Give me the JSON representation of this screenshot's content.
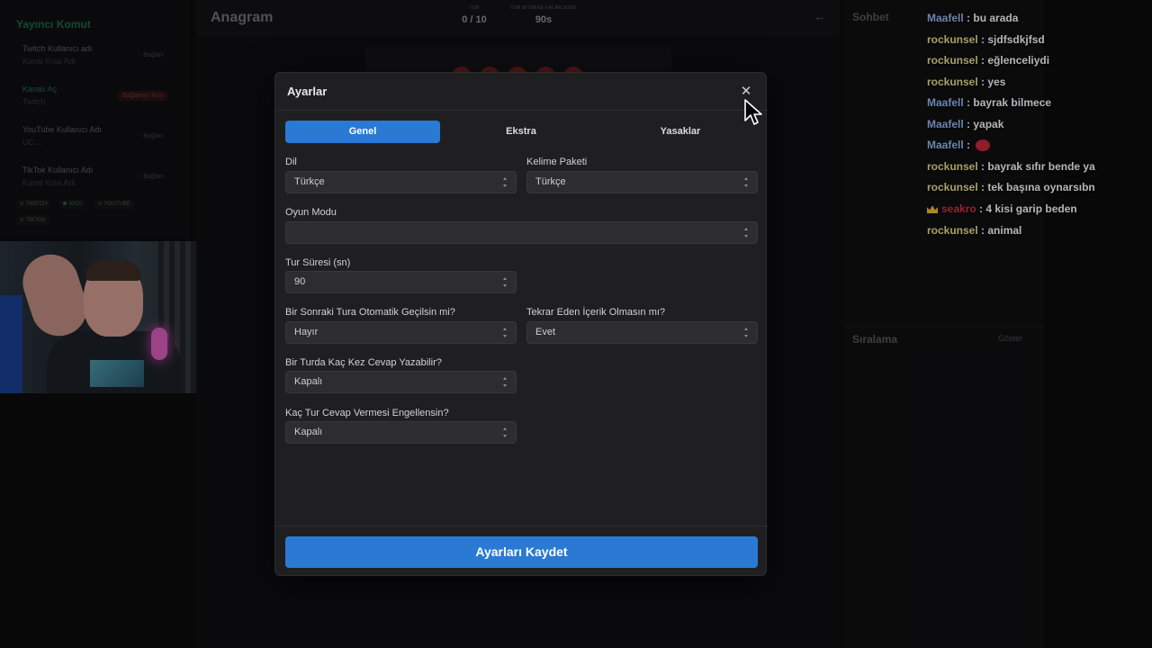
{
  "left_panel": {
    "title": "Yayıncı Komut",
    "connections": [
      {
        "label": "Twitch Kullanıcı adı",
        "sub": "Kanal Kısa Adı",
        "action": "Bağlan"
      },
      {
        "label": "Kanalı Aç",
        "sub": "Twitch",
        "action": "Bağlantıyı Kes"
      },
      {
        "label": "YouTube Kullanıcı Adı",
        "sub": "UC...",
        "action": "Bağlan"
      },
      {
        "label": "TikTok Kullanıcı Adı",
        "sub": "Kanal Kısa Adı",
        "action": "Bağlan"
      }
    ],
    "platforms": [
      "TWITCH",
      "KİCK",
      "YOUTUBE",
      "TİKTOK"
    ]
  },
  "game": {
    "title": "Anagram",
    "round_caption": "TUR",
    "round_value": "0 / 10",
    "timer_caption": "TUR BİTİMİNE KALAN SÜRE",
    "timer_value": "90s",
    "back_icon": "arrow-left-icon"
  },
  "right_panel": {
    "chat_title": "Sohbet",
    "ranking_title": "Sıralama",
    "ranking_action": "Göster"
  },
  "stream_chat": [
    {
      "user": "Maafell",
      "color": "#8fb4e8",
      "message": "bu arada"
    },
    {
      "user": "rockunsel",
      "color": "#e6d68a",
      "message": "sjdfsdkjfsd"
    },
    {
      "user": "rockunsel",
      "color": "#e6d68a",
      "message": "eğlenceliydi"
    },
    {
      "user": "rockunsel",
      "color": "#e6d68a",
      "message": "yes"
    },
    {
      "user": "Maafell",
      "color": "#8fb4e8",
      "message": "bayrak bilmece"
    },
    {
      "user": "Maafell",
      "color": "#8fb4e8",
      "message": "yapak"
    },
    {
      "user": "Maafell",
      "color": "#8fb4e8",
      "message": ""
    },
    {
      "user": "rockunsel",
      "color": "#e6d68a",
      "message": "bayrak sıfır bende ya"
    },
    {
      "user": "rockunsel",
      "color": "#e6d68a",
      "message": "tek başına oynarsıbn"
    },
    {
      "user": "seakro",
      "color": "#d42a3c",
      "message": "4 kisi garip beden"
    },
    {
      "user": "rockunsel",
      "color": "#e6d68a",
      "message": "animal"
    }
  ],
  "modal": {
    "title": "Ayarlar",
    "close_icon": "close-icon",
    "tabs": [
      {
        "label": "Genel",
        "active": true
      },
      {
        "label": "Ekstra",
        "active": false
      },
      {
        "label": "Yasaklar",
        "active": false
      }
    ],
    "fields": {
      "language": {
        "label": "Dil",
        "value": "Türkçe"
      },
      "word_pack": {
        "label": "Kelime Paketi",
        "value": "Türkçe"
      },
      "game_mode": {
        "label": "Oyun Modu",
        "value": ""
      },
      "round_duration": {
        "label": "Tur Süresi (sn)",
        "value": "90"
      },
      "auto_next": {
        "label": "Bir Sonraki Tura Otomatik Geçilsin mi?",
        "value": "Hayır"
      },
      "no_repeat": {
        "label": "Tekrar Eden İçerik Olmasın mı?",
        "value": "Evet"
      },
      "answers_per_round": {
        "label": "Bir Turda Kaç Kez Cevap Yazabilir?",
        "value": "Kapalı"
      },
      "block_rounds": {
        "label": "Kaç Tur Cevap Vermesi Engellensin?",
        "value": "Kapalı"
      }
    },
    "save_label": "Ayarları Kaydet"
  },
  "colors": {
    "accent": "#2a7ad3",
    "modal_bg": "#1f1f21",
    "danger": "#c94b4b",
    "success": "#2aa86e"
  }
}
